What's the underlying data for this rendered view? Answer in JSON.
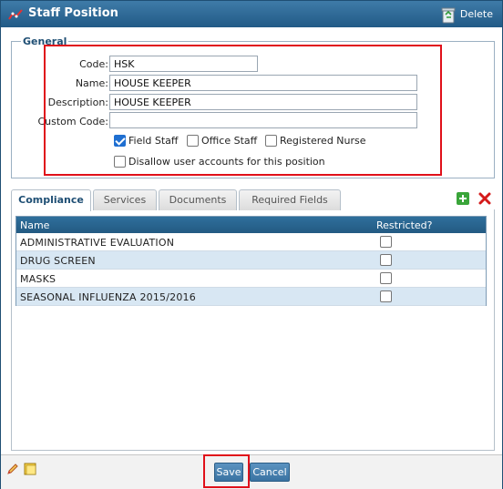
{
  "window": {
    "title": "Staff Position",
    "delete_label": "Delete"
  },
  "general": {
    "legend": "General",
    "fields": {
      "code": {
        "label": "Code:",
        "value": "HSK"
      },
      "name": {
        "label": "Name:",
        "value": "HOUSE KEEPER"
      },
      "description": {
        "label": "Description:",
        "value": "HOUSE KEEPER"
      },
      "custom_code": {
        "label": "Custom Code:",
        "value": ""
      }
    },
    "checkboxes": {
      "field_staff": {
        "label": "Field Staff",
        "checked": true
      },
      "office_staff": {
        "label": "Office Staff",
        "checked": false
      },
      "registered_nurse": {
        "label": "Registered Nurse",
        "checked": false
      },
      "disallow_accounts": {
        "label": "Disallow user accounts for this position",
        "checked": false
      }
    }
  },
  "tabs": [
    {
      "label": "Compliance",
      "active": true
    },
    {
      "label": "Services",
      "active": false
    },
    {
      "label": "Documents",
      "active": false
    },
    {
      "label": "Required Fields",
      "active": false
    }
  ],
  "grid": {
    "columns": {
      "name": "Name",
      "restricted": "Restricted?"
    },
    "rows": [
      {
        "name": "ADMINISTRATIVE EVALUATION",
        "restricted": false
      },
      {
        "name": "DRUG SCREEN",
        "restricted": false
      },
      {
        "name": "MASKS",
        "restricted": false
      },
      {
        "name": "SEASONAL INFLUENZA 2015/2016",
        "restricted": false
      }
    ]
  },
  "footer": {
    "save_label": "Save",
    "cancel_label": "Cancel"
  },
  "icons": {
    "title": "chart-icon",
    "delete": "recycle-bin-icon",
    "add": "plus-icon",
    "remove": "x-icon",
    "pencil": "pencil-icon",
    "note": "note-icon"
  },
  "colors": {
    "title_bar": "#225a86",
    "grid_header": "#235a82",
    "alt_row": "#d8e7f3",
    "highlight": "#e0101a",
    "button": "#3a73a2"
  }
}
